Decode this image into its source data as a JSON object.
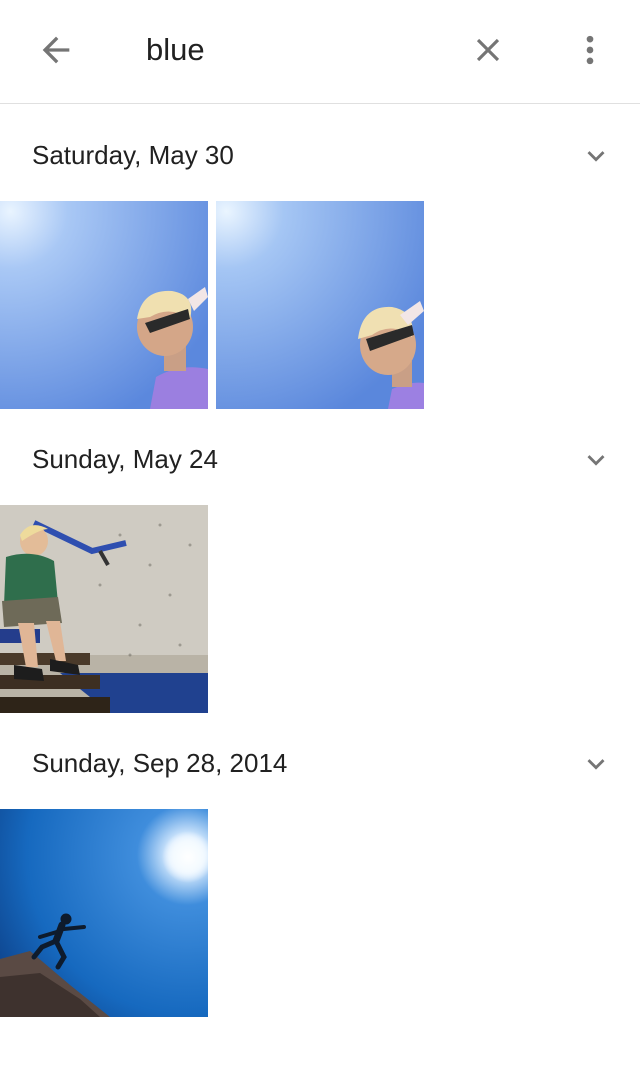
{
  "search": {
    "query": "blue"
  },
  "icons": {
    "back": "arrow-back-icon",
    "clear": "close-icon",
    "more": "more-vert-icon",
    "expand": "chevron-down-icon"
  },
  "colors": {
    "icon": "#757575",
    "divider": "#e0e0e0",
    "text": "#212121"
  },
  "sections": [
    {
      "date": "Saturday, May 30"
    },
    {
      "date": "Sunday, May 24"
    },
    {
      "date": "Sunday, Sep 28, 2014"
    }
  ]
}
